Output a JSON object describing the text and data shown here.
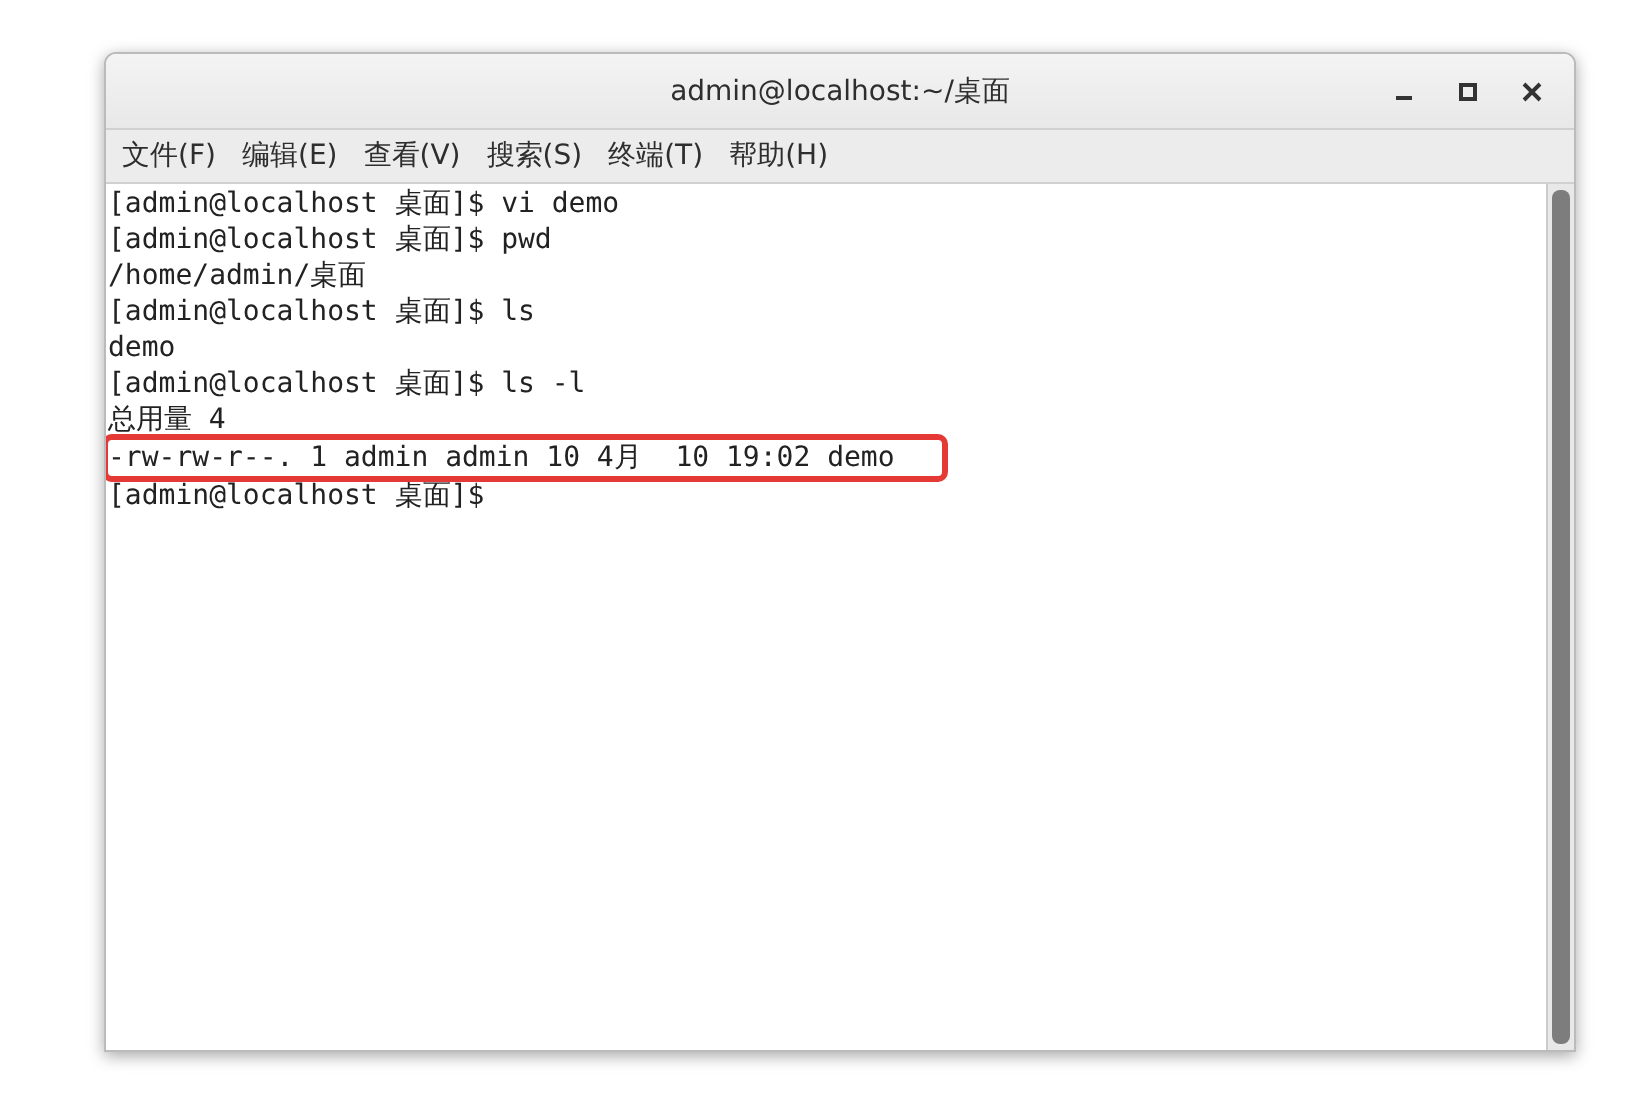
{
  "window": {
    "title": "admin@localhost:~/桌面"
  },
  "menu": [
    "文件(F)",
    "编辑(E)",
    "查看(V)",
    "搜索(S)",
    "终端(T)",
    "帮助(H)"
  ],
  "terminal": {
    "lines": [
      {
        "text": "[admin@localhost 桌面]$ vi demo",
        "highlighted": false
      },
      {
        "text": "[admin@localhost 桌面]$ pwd",
        "highlighted": false
      },
      {
        "text": "/home/admin/桌面",
        "highlighted": false
      },
      {
        "text": "[admin@localhost 桌面]$ ls",
        "highlighted": false
      },
      {
        "text": "demo",
        "highlighted": false
      },
      {
        "text": "[admin@localhost 桌面]$ ls -l",
        "highlighted": false
      },
      {
        "text": "总用量 4",
        "highlighted": false
      },
      {
        "text": "-rw-rw-r--. 1 admin admin 10 4月  10 19:02 demo",
        "highlighted": true
      },
      {
        "text": "[admin@localhost 桌面]$",
        "highlighted": false
      }
    ]
  }
}
